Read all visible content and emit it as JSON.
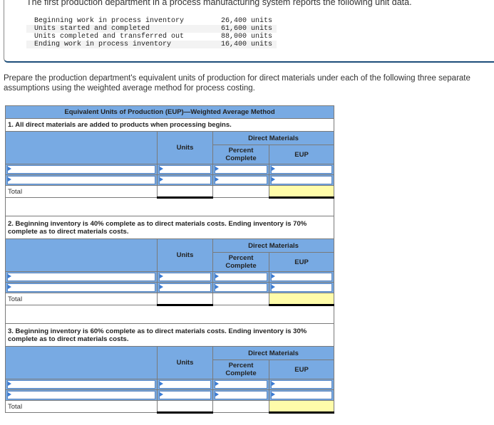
{
  "intro": "The first production department in a process manufacturing system reports the following unit data.",
  "unit_data": [
    {
      "label": "Beginning work in process inventory",
      "value": "26,400 units"
    },
    {
      "label": "Units started and completed",
      "value": "61,600 units"
    },
    {
      "label": "Units completed and transferred out",
      "value": "88,000 units"
    },
    {
      "label": "Ending work in process inventory",
      "value": "16,400 units"
    }
  ],
  "instructions": "Prepare the production department's equivalent units of production for direct materials under each of the following three separate assumptions using the weighted average method for process costing.",
  "table": {
    "title": "Equivalent Units of Production (EUP)—Weighted Average Method",
    "headers": {
      "units": "Units",
      "direct_materials": "Direct Materials",
      "percent_complete": "Percent Complete",
      "eup": "EUP"
    },
    "total_label": "Total",
    "cases": [
      {
        "text": "1. All direct materials are added to products when processing begins."
      },
      {
        "text": "2. Beginning inventory is 40% complete as to direct materials costs. Ending inventory is 70% complete as to direct materials costs."
      },
      {
        "text": "3. Beginning inventory is 60% complete as to direct materials costs. Ending inventory is 30% complete as to direct materials costs."
      }
    ]
  }
}
